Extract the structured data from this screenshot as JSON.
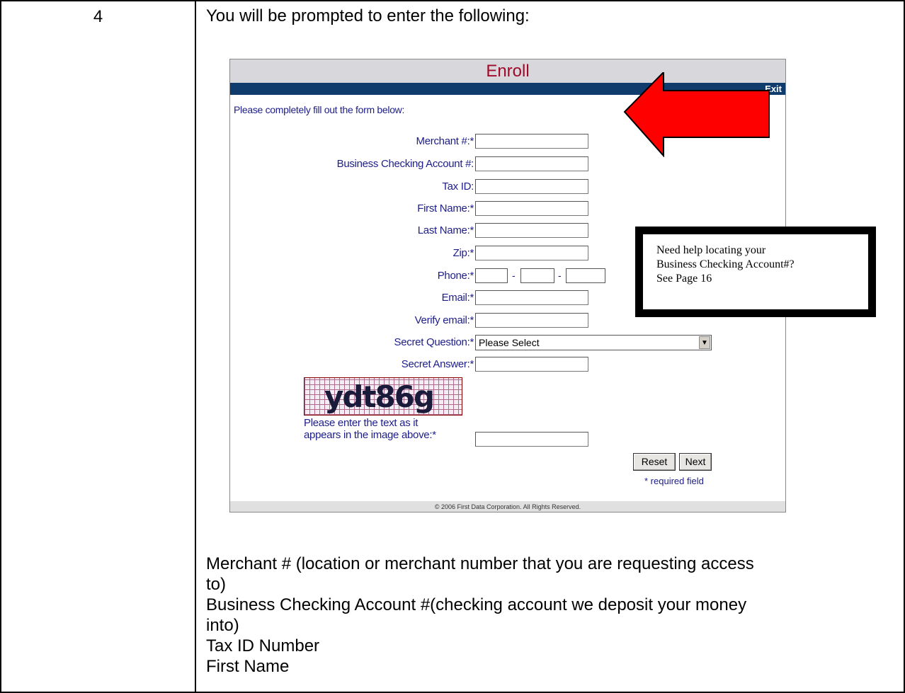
{
  "step_number": "4",
  "intro_text": "You will be prompted to enter the following:",
  "enroll": {
    "title": "Enroll",
    "exit_label": "Exit",
    "instruction": "Please completely fill out the form below:",
    "labels": {
      "merchant": "Merchant #:*",
      "business_checking": "Business Checking Account #:",
      "tax_id": "Tax ID:",
      "first_name": "First Name:*",
      "last_name": "Last Name:*",
      "zip": "Zip:*",
      "phone": "Phone:*",
      "email": "Email:*",
      "verify_email": "Verify email:*",
      "secret_question": "Secret Question:*",
      "secret_answer": "Secret Answer:*"
    },
    "phone_separator": "-",
    "secret_question_value": "Please Select",
    "captcha_text": "ydt86g",
    "captcha_prompt_line1": "Please enter the text as it",
    "captcha_prompt_line2": "appears in the image above:*",
    "reset_label": "Reset",
    "next_label": "Next",
    "required_note": "* required field",
    "footer": "© 2006 First Data Corporation. All Rights Reserved."
  },
  "callout": {
    "line1": "Need help locating your",
    "line2": "Business Checking Account#?",
    "line3": "See Page 16"
  },
  "notes": [
    "Merchant # (location or merchant number that you are requesting access",
    "to)",
    "Business Checking Account #(checking account we deposit your money",
    "into)",
    "Tax ID Number",
    "First Name"
  ],
  "colors": {
    "title_red": "#a00a2a",
    "bar_navy": "#0f3c6c",
    "label_blue": "#1d1d8a",
    "arrow_red": "#ff0000"
  }
}
